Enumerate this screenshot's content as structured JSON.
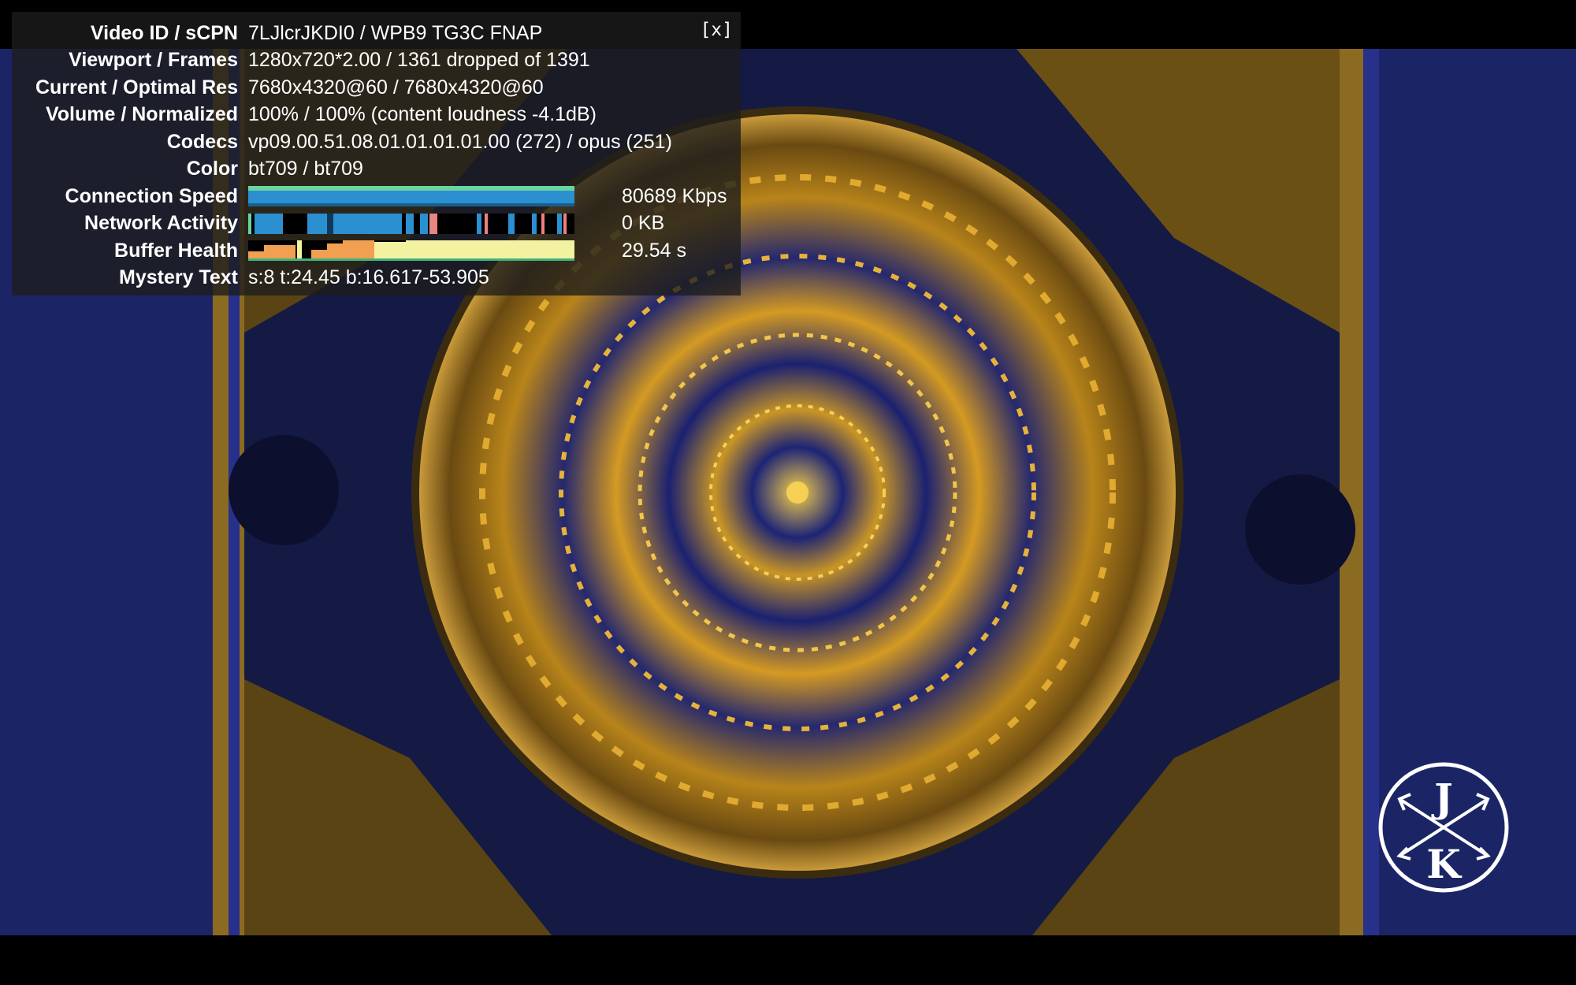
{
  "stats": {
    "rows": [
      {
        "label": "Video ID / sCPN",
        "value": "7LJlcrJKDI0 / WPB9 TG3C FNAP"
      },
      {
        "label": "Viewport / Frames",
        "value": "1280x720*2.00 / 1361 dropped of 1391"
      },
      {
        "label": "Current / Optimal Res",
        "value": "7680x4320@60 / 7680x4320@60"
      },
      {
        "label": "Volume / Normalized",
        "value": "100% / 100% (content loudness -4.1dB)"
      },
      {
        "label": "Codecs",
        "value": "vp09.00.51.08.01.01.01.01.00 (272) / opus (251)"
      },
      {
        "label": "Color",
        "value": "bt709 / bt709"
      }
    ],
    "graphs": [
      {
        "label": "Connection Speed",
        "value": "80689 Kbps"
      },
      {
        "label": "Network Activity",
        "value": "0 KB"
      },
      {
        "label": "Buffer Health",
        "value": "29.54 s"
      }
    ],
    "mystery": {
      "label": "Mystery Text",
      "value": "s:8 t:24.45 b:16.617-53.905"
    },
    "close_label": "[x]"
  },
  "watermark": {
    "letters": [
      "J",
      "K"
    ]
  },
  "colors": {
    "panel_bg": "#1c1c1c",
    "conn_blue": "#2b8fd0",
    "conn_green": "#6ad3a0",
    "buffer_yellow": "#f2f2a0",
    "buffer_orange": "#f0a050",
    "net_blue": "#2b8fd0",
    "net_pink": "#f08080"
  },
  "icons": [
    "close-icon",
    "jk-arrows-logo-icon"
  ]
}
